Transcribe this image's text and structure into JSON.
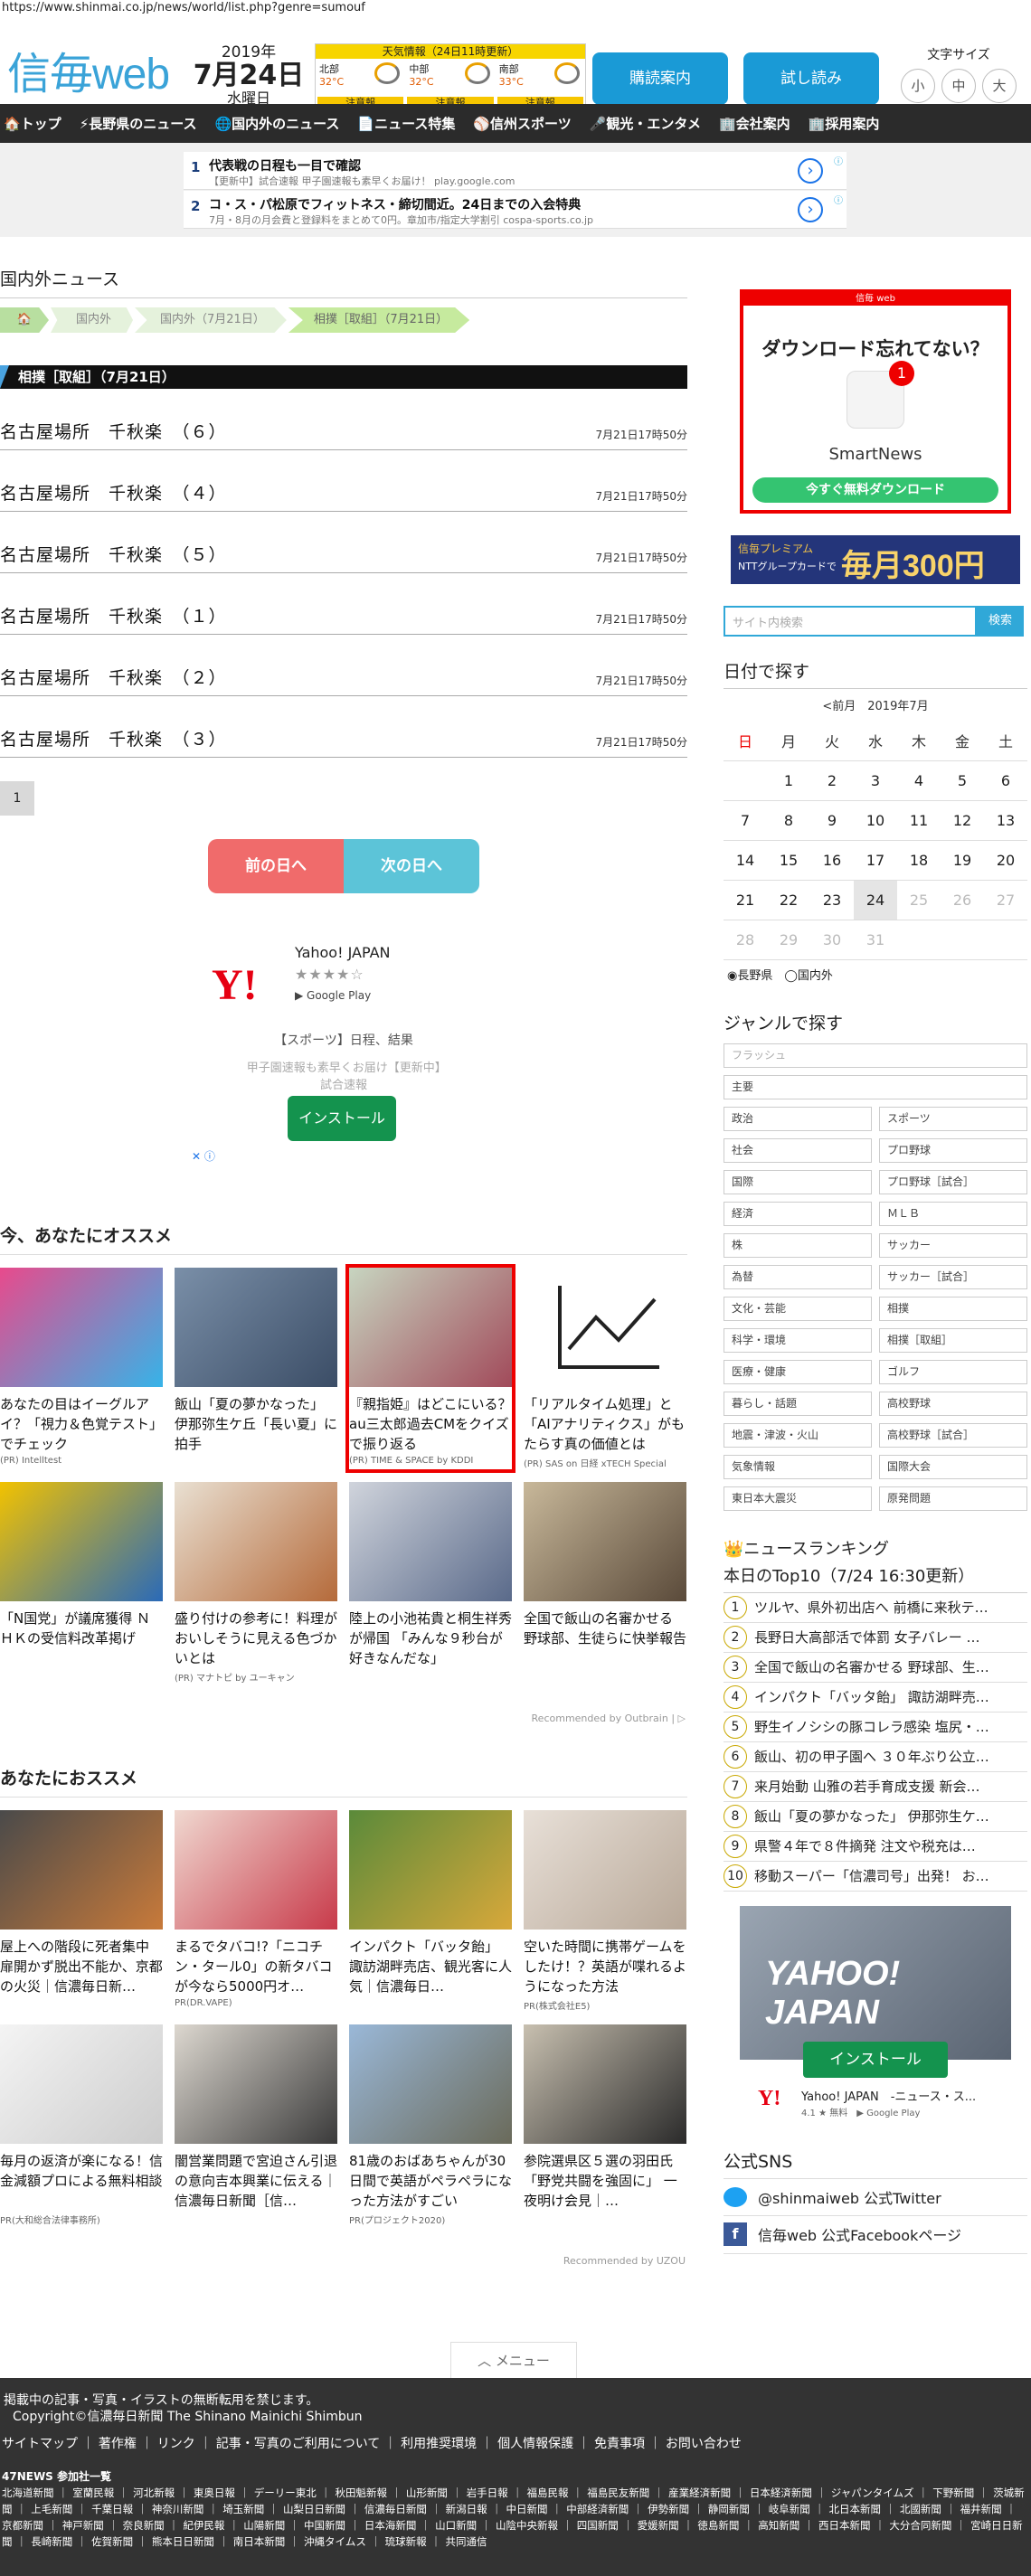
{
  "url": "https://www.shinmai.co.jp/news/world/list.php?genre=sumouf",
  "header": {
    "logo": "信毎web",
    "year": "2019年",
    "month_day": "7月24日",
    "weekday": "水曜日",
    "weather": {
      "title": "天気情報（24日11時更新）",
      "regions": [
        {
          "name": "北部",
          "temp": "32°C",
          "warn": "注意報"
        },
        {
          "name": "中部",
          "temp": "32°C",
          "warn": "注意報"
        },
        {
          "name": "南部",
          "temp": "33°C",
          "warn": "注意報"
        }
      ]
    },
    "subscribe_label": "購読案内",
    "trial_label": "試し読み",
    "font_size_label": "文字サイズ",
    "font_sizes": [
      "小",
      "中",
      "大"
    ]
  },
  "nav": [
    "🏠トップ",
    "⚡長野県のニュース",
    "🌐国内外のニュース",
    "📄ニュース特集",
    "⚾信州スポーツ",
    "🎤観光・エンタメ",
    "🏢会社案内",
    "🏢採用案内"
  ],
  "ads": [
    {
      "num": "1",
      "title": "代表戦の日程も一目で確認",
      "sub": "【更新中】試合速報 甲子園速報も素早くお届け！ play.google.com"
    },
    {
      "num": "2",
      "title": "コ・ス・パ松原でフィットネス・締切間近。24日までの入会特典",
      "sub": "7月・8月の月会費と登録料をまとめて0円。章加市/指定大学割引 cospa-sports.co.jp"
    }
  ],
  "main": {
    "section_title": "国内外ニュース",
    "breadcrumb": [
      "🏠",
      "国内外",
      "国内外（7月21日）",
      "相撲［取組］（7月21日）"
    ],
    "category": "相撲［取組］（7月21日）",
    "items": [
      {
        "title": "名古屋場所　千秋楽　（６）",
        "time": "7月21日17時50分"
      },
      {
        "title": "名古屋場所　千秋楽　（４）",
        "time": "7月21日17時50分"
      },
      {
        "title": "名古屋場所　千秋楽　（５）",
        "time": "7月21日17時50分"
      },
      {
        "title": "名古屋場所　千秋楽　（１）",
        "time": "7月21日17時50分"
      },
      {
        "title": "名古屋場所　千秋楽　（２）",
        "time": "7月21日17時50分"
      },
      {
        "title": "名古屋場所　千秋楽　（３）",
        "time": "7月21日17時50分"
      }
    ],
    "page": "1",
    "prev_day": "前の日へ",
    "next_day": "次の日へ",
    "yahoo_ad": {
      "name": "Yahoo! JAPAN",
      "stars": "★★★★☆",
      "store": "▶ Google Play",
      "desc1": "【スポーツ】日程、結果",
      "desc2": "甲子園速報も素早くお届け【更新中】試合速報",
      "install": "インストール",
      "adchoice": "✕ ⓘ"
    }
  },
  "recommend1": {
    "title": "今、あなたにオススメ",
    "cards": [
      {
        "text": "あなたの目はイーグルアイ？「視力＆色覚テスト」でチェック",
        "pr": "(PR) Intelltest",
        "c1": "#e84a8c",
        "c2": "#36b3e8"
      },
      {
        "text": "飯山「夏の夢かなった」　伊那弥生ケ丘「長い夏」に拍手",
        "pr": "",
        "c1": "#7a8fa8",
        "c2": "#3b4d66"
      },
      {
        "text": "『親指姫』はどこにいる？ au三太郎過去CMをクイズで振り返る",
        "pr": "(PR) TIME & SPACE by KDDI",
        "c1": "#c7d5c0",
        "c2": "#a14a5a"
      },
      {
        "text": "「リアルタイム処理」と「AIアナリティクス」がもたらす真の価値とは",
        "pr": "(PR) SAS on 日経 xTECH Special",
        "c1": "#ffffff",
        "c2": "#ffffff"
      },
      {
        "text": "「N国党」が議席獲得 ＮＨＫの受信料改革掲げ",
        "pr": "",
        "c1": "#f2c200",
        "c2": "#2a6ab8"
      },
      {
        "text": "盛り付けの参考に！料理がおいしそうに見える色づかいとは",
        "pr": "(PR) マナトピ by ユーキャン",
        "c1": "#e9e0d2",
        "c2": "#b56a3a"
      },
      {
        "text": "陸上の小池祐貴と桐生祥秀が帰国 「みんな９秒台が好きなんだな」",
        "pr": "",
        "c1": "#d0d4dc",
        "c2": "#5a6a8a"
      },
      {
        "text": "全国で飯山の名審かせる　野球部、生徒らに快挙報告",
        "pr": "",
        "c1": "#c8b89a",
        "c2": "#5a4a3a"
      }
    ],
    "outbrain": "Recommended by Outbrain | ▷"
  },
  "recommend2": {
    "title": "あなたにおススメ",
    "cards": [
      {
        "text": "屋上への階段に死者集中 扉開かず脱出不能か、京都の火災｜信濃毎日新…",
        "pr": "",
        "c1": "#4a4a4a",
        "c2": "#c87a3a"
      },
      {
        "text": "まるでタバコ!?「ニコチン・タール0」の新タバコが今なら5000円オ…",
        "pr": "PR(DR.VAPE)",
        "c1": "#f0d8d0",
        "c2": "#c83a4a"
      },
      {
        "text": "インパクト「バッタ飴」 諏訪湖畔売店、観光客に人気｜信濃毎日…",
        "pr": "",
        "c1": "#5a8a3a",
        "c2": "#d8a83a"
      },
      {
        "text": "空いた時間に携帯ゲームをしたけ！？英語が喋れるようになった方法",
        "pr": "PR(株式会社E5)",
        "c1": "#e8e0d8",
        "c2": "#b8a898"
      },
      {
        "text": "毎月の返済が楽になる！信金減額プロによる無料相談",
        "pr": "PR(大和総合法律事務所)",
        "c1": "#f4f4f4",
        "c2": "#cccccc"
      },
      {
        "text": "闇営業問題で宮迫さん引退の意向吉本興業に伝える｜信濃毎日新聞［信…",
        "pr": "",
        "c1": "#ddd8d0",
        "c2": "#3a3a3a"
      },
      {
        "text": "81歳のおばあちゃんが30日間で英語がペラペラになった方法がすごい",
        "pr": "PR(プロジェクト2020)",
        "c1": "#9ab8d8",
        "c2": "#6a6a5a"
      },
      {
        "text": "参院選県区５選の羽田氏 「野党共闘を強固に」 一夜明け会見｜…",
        "pr": "",
        "c1": "#c8c0b0",
        "c2": "#2a2a2a"
      }
    ],
    "recommended": "Recommended by UZOU"
  },
  "sidebar": {
    "ad": {
      "top": "信毎 web",
      "q": "ダウンロード忘れてない？",
      "app": "SmartNews",
      "btn": "今すぐ無料ダウンロード"
    },
    "premium": {
      "a": "信毎プレミアム",
      "b": "NTTグループカードで",
      "c": "毎月300円"
    },
    "search_placeholder": "サイト内検索",
    "search_btn": "検索",
    "date_title": "日付で探す",
    "cal_month": "<前月　2019年7月",
    "weekdays": [
      "日",
      "月",
      "火",
      "水",
      "木",
      "金",
      "土"
    ],
    "weeks": [
      [
        "",
        "1",
        "2",
        "3",
        "4",
        "5",
        "6"
      ],
      [
        "7",
        "8",
        "9",
        "10",
        "11",
        "12",
        "13"
      ],
      [
        "14",
        "15",
        "16",
        "17",
        "18",
        "19",
        "20"
      ],
      [
        "21",
        "22",
        "23",
        "24",
        "25",
        "26",
        "27"
      ],
      [
        "28",
        "29",
        "30",
        "31",
        "",
        "",
        ""
      ]
    ],
    "cal_opt": "◉長野県　◯国内外",
    "genre_title": "ジャンルで探す",
    "genre_top": [
      "フラッシュ",
      "主要"
    ],
    "genres": [
      [
        "政治",
        "スポーツ"
      ],
      [
        "社会",
        "プロ野球"
      ],
      [
        "国際",
        "プロ野球［試合］"
      ],
      [
        "経済",
        "ＭＬＢ"
      ],
      [
        "株",
        "サッカー"
      ],
      [
        "為替",
        "サッカー［試合］"
      ],
      [
        "文化・芸能",
        "相撲"
      ],
      [
        "科学・環境",
        "相撲［取組］"
      ],
      [
        "医療・健康",
        "ゴルフ"
      ],
      [
        "暮らし・話題",
        "高校野球"
      ],
      [
        "地震・津波・火山",
        "高校野球［試合］"
      ],
      [
        "気象情報",
        "国際大会"
      ],
      [
        "東日本大震災",
        "原発問題"
      ]
    ],
    "ranking_title": "👑ニュースランキング",
    "ranking_sub": "本日のTop10（7/24 16:30更新）",
    "ranking": [
      "ツルヤ、県外初出店へ 前橋に来秋テ…",
      "長野日大高部活で体罰 女子バレー …",
      "全国で飯山の名審かせる 野球部、生…",
      "インパクト「バッタ飴」 諏訪湖畔売…",
      "野生イノシシの豚コレラ感染 塩尻・…",
      "飯山、初の甲子園へ ３０年ぶり公立…",
      "来月始動 山雅の若手育成支援 新会…",
      "飯山「夏の夢かなった」 伊那弥生ケ…",
      "県警４年で８件摘発 注文や税充は…",
      "移動スーパー「信濃司号」出発！ お…"
    ],
    "yad2": {
      "brand": "YAHOO! JAPAN",
      "install": "インストール",
      "name": "Yahoo! JAPAN　-ニュース・ス...",
      "stat": "4.1 ★ 無料　▶ Google Play"
    },
    "sns_title": "公式SNS",
    "twitter": "@shinmaiweb 公式Twitter",
    "facebook": "信毎web 公式Facebookページ"
  },
  "footer": {
    "menu": "︿ メニュー",
    "t1": "掲載中の記事・写真・イラストの無断転用を禁じます。",
    "t2": "Copyright©信濃毎日新聞 The Shinano Mainichi Shimbun",
    "links": "サイトマップ ｜ 著作権 ｜ リンク ｜ 記事・写真のご利用について ｜ 利用推奨環境 ｜ 個人情報保護 ｜ 免責事項 ｜ お問い合わせ",
    "h47": "47NEWS 参加社一覧",
    "papers": "北海道新聞 ｜ 室蘭民報 ｜ 河北新報 ｜ 東奥日報 ｜ デーリー東北 ｜ 秋田魁新報 ｜ 山形新聞 ｜ 岩手日報 ｜ 福島民報 ｜ 福島民友新聞 ｜ 産業経済新聞 ｜ 日本経済新聞 ｜ ジャパンタイムズ ｜ 下野新聞 ｜ 茨城新聞 ｜ 上毛新聞 ｜ 千葉日報 ｜ 神奈川新聞 ｜ 埼玉新聞 ｜ 山梨日日新聞 ｜ 信濃毎日新聞 ｜ 新潟日報 ｜ 中日新聞 ｜ 中部経済新聞 ｜ 伊勢新聞 ｜ 静岡新聞 ｜ 岐阜新聞 ｜ 北日本新聞 ｜ 北國新聞 ｜ 福井新聞 ｜ 京都新聞 ｜ 神戸新聞 ｜ 奈良新聞 ｜ 紀伊民報 ｜ 山陽新聞 ｜ 中国新聞 ｜ 日本海新聞 ｜ 山口新聞 ｜ 山陰中央新報 ｜ 四国新聞 ｜ 愛媛新聞 ｜ 徳島新聞 ｜ 高知新聞 ｜ 西日本新聞 ｜ 大分合同新聞 ｜ 宮崎日日新聞 ｜ 長崎新聞 ｜ 佐賀新聞 ｜ 熊本日日新聞 ｜ 南日本新聞 ｜ 沖縄タイムス ｜ 琉球新報 ｜ 共同通信"
  }
}
